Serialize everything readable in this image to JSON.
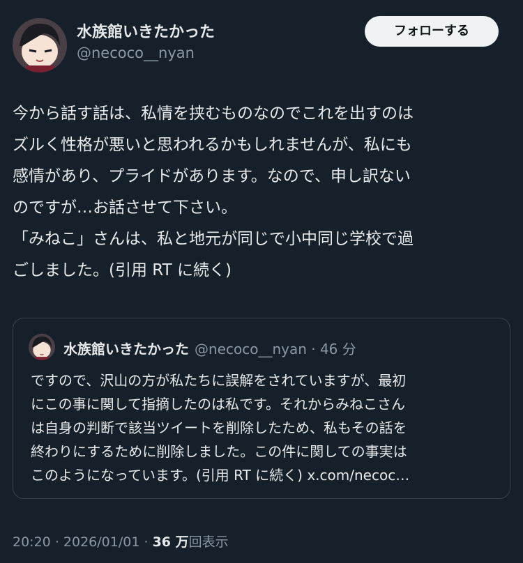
{
  "author": {
    "name": "水族館いきたかった",
    "handle": "@necoco__nyan"
  },
  "follow_label": "フォローする",
  "tweet_lines": [
    "今から話す話は、私情を挟むものなのでこれを出すのは",
    "ズルく性格が悪いと思われるかもしれませんが、私にも",
    "感情があり、プライドがあります。なので、申し訳ない",
    "のですが…お話させて下さい。",
    "「みねこ」さんは、私と地元が同じで小中同じ学校で過",
    "ごしました。(引用 RT に続く)"
  ],
  "quote": {
    "name": "水族館いきたかった",
    "meta": "@necoco__nyan · 46 分",
    "lines": [
      "ですので、沢山の方が私たちに誤解をされていますが、最初",
      "にこの事に関して指摘したのは私です。それからみねこさん",
      "は自身の判断で該当ツイートを削除したため、私もその話を",
      "終わりにするために削除しました。この件に関しての事実は",
      "このようになっています。(引用 RT に続く) x.com/necoc…"
    ]
  },
  "footer": {
    "time": "20:20",
    "date": "2026/01/01",
    "views": "36 万",
    "views_label": "回表示",
    "separator": "·"
  },
  "colors": {
    "background": "#15202b",
    "text": "#e7e9ea",
    "muted": "#8b98a5",
    "button_bg": "#eff3f4",
    "border": "#38444d"
  }
}
